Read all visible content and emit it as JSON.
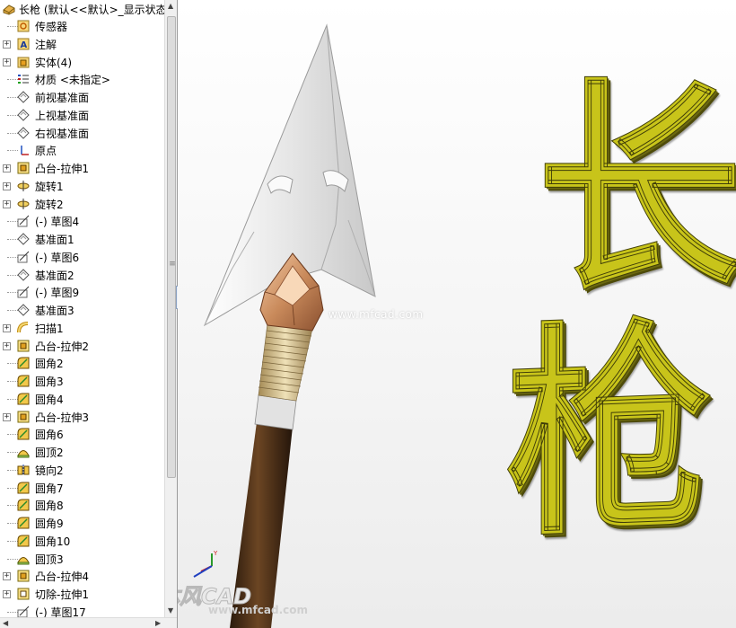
{
  "tree": {
    "title": "长枪  (默认<<默认>_显示状态",
    "items": [
      {
        "label": "传感器",
        "icon": "sensor-icon",
        "expandable": false
      },
      {
        "label": "注解",
        "icon": "annotation-icon",
        "expandable": true
      },
      {
        "label": "实体(4)",
        "icon": "solid-bodies-folder-icon",
        "expandable": true
      },
      {
        "label": "材质 <未指定>",
        "icon": "material-icon",
        "expandable": false
      },
      {
        "label": "前视基准面",
        "icon": "plane-icon",
        "expandable": false
      },
      {
        "label": "上视基准面",
        "icon": "plane-icon",
        "expandable": false
      },
      {
        "label": "右视基准面",
        "icon": "plane-icon",
        "expandable": false
      },
      {
        "label": "原点",
        "icon": "origin-icon",
        "expandable": false
      },
      {
        "label": "凸台-拉伸1",
        "icon": "boss-extrude-icon",
        "expandable": true
      },
      {
        "label": "旋转1",
        "icon": "revolve-icon",
        "expandable": true
      },
      {
        "label": "旋转2",
        "icon": "revolve-icon",
        "expandable": true
      },
      {
        "label": "(-) 草图4",
        "icon": "sketch-icon",
        "expandable": false
      },
      {
        "label": "基准面1",
        "icon": "plane-icon",
        "expandable": false
      },
      {
        "label": "(-) 草图6",
        "icon": "sketch-icon",
        "expandable": false
      },
      {
        "label": "基准面2",
        "icon": "plane-icon",
        "expandable": false
      },
      {
        "label": "(-) 草图9",
        "icon": "sketch-icon",
        "expandable": false
      },
      {
        "label": "基准面3",
        "icon": "plane-icon",
        "expandable": false
      },
      {
        "label": "扫描1",
        "icon": "sweep-icon",
        "expandable": true
      },
      {
        "label": "凸台-拉伸2",
        "icon": "boss-extrude-icon",
        "expandable": true
      },
      {
        "label": "圆角2",
        "icon": "fillet-icon",
        "expandable": false
      },
      {
        "label": "圆角3",
        "icon": "fillet-icon",
        "expandable": false
      },
      {
        "label": "圆角4",
        "icon": "fillet-icon",
        "expandable": false
      },
      {
        "label": "凸台-拉伸3",
        "icon": "boss-extrude-icon",
        "expandable": true
      },
      {
        "label": "圆角6",
        "icon": "fillet-icon",
        "expandable": false
      },
      {
        "label": "圆顶2",
        "icon": "dome-icon",
        "expandable": false
      },
      {
        "label": "镜向2",
        "icon": "mirror-icon",
        "expandable": false
      },
      {
        "label": "圆角7",
        "icon": "fillet-icon",
        "expandable": false
      },
      {
        "label": "圆角8",
        "icon": "fillet-icon",
        "expandable": false
      },
      {
        "label": "圆角9",
        "icon": "fillet-icon",
        "expandable": false
      },
      {
        "label": "圆角10",
        "icon": "fillet-icon",
        "expandable": false
      },
      {
        "label": "圆顶3",
        "icon": "dome-icon",
        "expandable": false
      },
      {
        "label": "凸台-拉伸4",
        "icon": "boss-extrude-icon",
        "expandable": true
      },
      {
        "label": "切除-拉伸1",
        "icon": "cut-extrude-icon",
        "expandable": true
      },
      {
        "label": "(-) 草图17",
        "icon": "sketch-icon",
        "expandable": false
      }
    ]
  },
  "viewport": {
    "title_chars": [
      "长",
      "枪"
    ],
    "watermark_center": "www.mfcad.com",
    "watermark_logo": "沐风CAD",
    "watermark_url": "www.mfcad.com"
  },
  "colors": {
    "title_text": "#c8c41a",
    "spear_blade": "#dcdcdc",
    "spear_socket": "#c8895a",
    "spear_thread": "#cdb98a",
    "spear_shaft": "#5a3a1e",
    "spear_band": "#d8d8d8"
  }
}
